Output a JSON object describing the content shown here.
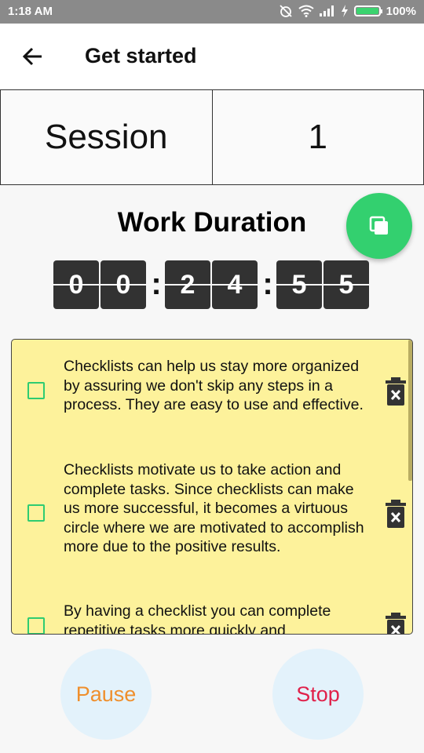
{
  "status_bar": {
    "time": "1:18 AM",
    "battery": "100%",
    "battery_level": 1.0,
    "icons": [
      "alarm-off-icon",
      "wifi-icon",
      "signal-icon",
      "charging-icon",
      "battery-icon"
    ]
  },
  "app_bar": {
    "title": "Get started",
    "back_icon": "arrow-back-icon"
  },
  "session": {
    "label": "Session",
    "value": "1"
  },
  "work_duration": {
    "title": "Work Duration",
    "fab_icon": "copy-icon",
    "digits": [
      "0",
      "0",
      "2",
      "4",
      "5",
      "5"
    ],
    "separator": ":"
  },
  "checklist": {
    "background": "#fdf29b",
    "items": [
      {
        "text": "Checklists can help us stay more organized by assuring we don't skip any steps in a process. They are easy to use and effective.",
        "checked": false,
        "delete_icon": "trash-icon"
      },
      {
        "text": "Checklists motivate us to take action and complete tasks. Since checklists can make us more successful, it becomes a virtuous circle where we are motivated to accomplish more due to the positive results.",
        "checked": false,
        "delete_icon": "trash-icon"
      },
      {
        "text": "By having a checklist you can complete repetitive tasks more quickly and",
        "checked": false,
        "delete_icon": "trash-icon"
      }
    ]
  },
  "controls": {
    "pause_label": "Pause",
    "stop_label": "Stop"
  },
  "colors": {
    "accent_green": "#33d06f",
    "pause": "#ef8f2c",
    "stop": "#e0214a",
    "button_bg": "#e3f2fb",
    "digit_bg": "#323232"
  }
}
